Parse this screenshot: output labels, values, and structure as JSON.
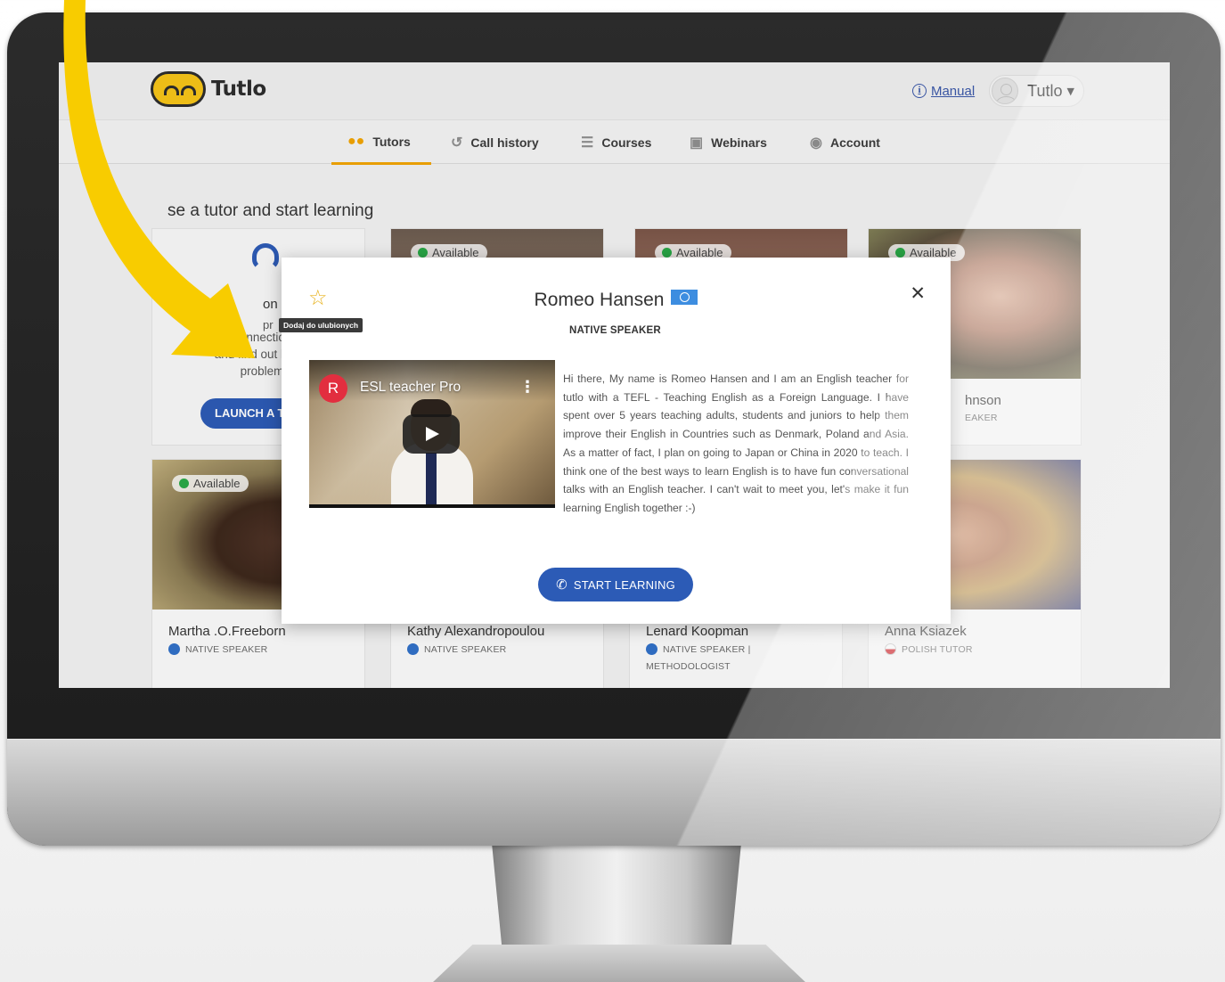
{
  "header": {
    "brand": "Tutlo",
    "manual_label": "Manual",
    "user_name": "Tutlo"
  },
  "nav": {
    "items": [
      {
        "label": "Tutors",
        "icon": "tutors-icon",
        "active": true
      },
      {
        "label": "Call history",
        "icon": "history-icon"
      },
      {
        "label": "Courses",
        "icon": "list-icon"
      },
      {
        "label": "Webinars",
        "icon": "webinar-icon"
      },
      {
        "label": "Account",
        "icon": "account-icon"
      }
    ]
  },
  "page": {
    "title_visible": "se a tutor and start learning"
  },
  "help_card": {
    "heading_fragment": "on",
    "line_fragment": "pr",
    "text": "the connection? R\nand find out how t\nproblem",
    "button_label": "LAUNCH A T"
  },
  "tutors": [
    {
      "name": "Martha .O.Freeborn",
      "role": "NATIVE SPEAKER",
      "status": "Available"
    },
    {
      "name": "Kathy Alexandropoulou",
      "role": "NATIVE SPEAKER",
      "status": "Available"
    },
    {
      "name": "Lenard Koopman",
      "role": "NATIVE SPEAKER |",
      "role2": "METHODOLOGIST",
      "status": "Available"
    },
    {
      "name": "Anna Ksiazek",
      "role": "POLISH TUTOR",
      "status": "Available"
    }
  ],
  "top_tutors": {
    "partial_name": "hnson",
    "partial_role": "EAKER",
    "status": "Available"
  },
  "modal": {
    "favorite_tooltip": "Dodaj do ulubionych",
    "tutor_name": "Romeo Hansen",
    "subtitle": "NATIVE SPEAKER",
    "video": {
      "channel_initial": "R",
      "title": "ESL teacher Pro"
    },
    "bio": "Hi there, My name is Romeo Hansen and I am an English teacher for tutlo with a TEFL - Teaching English as a Foreign Language. I have spent over 5 years teaching adults, students and juniors to help them improve their English in Countries such as Denmark, Poland and Asia. As a matter of fact, I plan on going to Japan or China in 2020 to teach. I think one of the best ways to learn English is to have fun conversational talks with an English teacher. I can't wait to meet you, let's make it fun learning English together :-)",
    "start_button": "START LEARNING"
  },
  "colors": {
    "accent": "#f2a400",
    "primary_button": "#2c5bb6",
    "available": "#27a845",
    "arrow": "#f8cc00"
  }
}
